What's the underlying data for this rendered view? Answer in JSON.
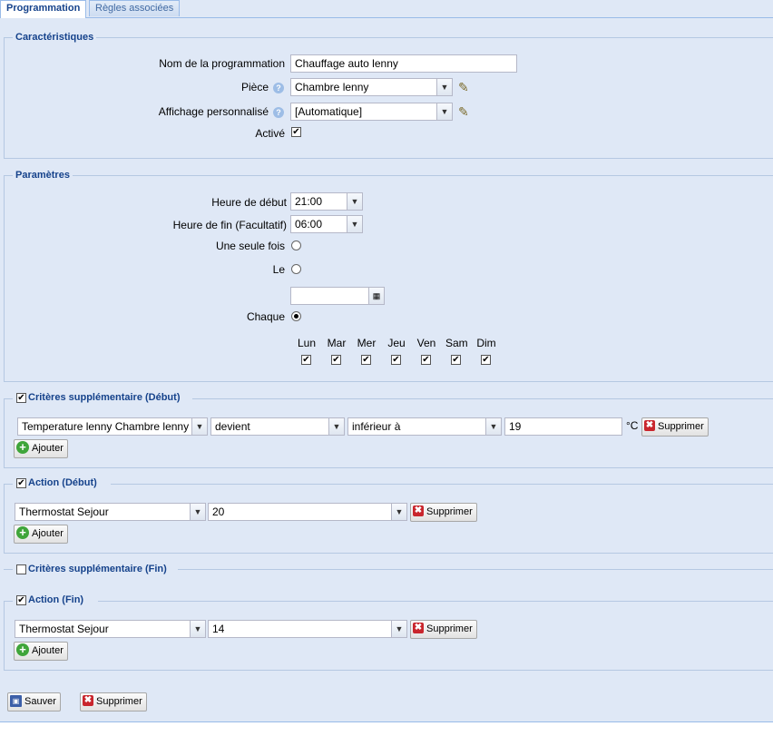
{
  "tabs": [
    {
      "label": "Programmation",
      "active": true
    },
    {
      "label": "Règles associées",
      "active": false
    }
  ],
  "characteristics": {
    "legend": "Caractéristiques",
    "name_label": "Nom de la programmation",
    "name_value": "Chauffage auto lenny",
    "room_label": "Pièce",
    "room_value": "Chambre lenny",
    "display_label": "Affichage personnalisé",
    "display_value": "[Automatique]",
    "active_label": "Activé",
    "active_checked": true
  },
  "parameters": {
    "legend": "Paramètres",
    "start_label": "Heure de début",
    "start_value": "21:00",
    "end_label": "Heure de fin (Facultatif)",
    "end_value": "06:00",
    "once_label": "Une seule fois",
    "on_label": "Le",
    "date_value": "",
    "every_label": "Chaque",
    "selected_mode": "every",
    "days": [
      {
        "label": "Lun",
        "checked": true
      },
      {
        "label": "Mar",
        "checked": true
      },
      {
        "label": "Mer",
        "checked": true
      },
      {
        "label": "Jeu",
        "checked": true
      },
      {
        "label": "Ven",
        "checked": true
      },
      {
        "label": "Sam",
        "checked": true
      },
      {
        "label": "Dim",
        "checked": true
      }
    ]
  },
  "criteria_start": {
    "legend": "Critères supplémentaire (Début)",
    "checked": true,
    "sensor": "Temperature lenny Chambre lenny",
    "condition": "devient",
    "operator": "inférieur à",
    "value": "19",
    "unit": "°C",
    "delete_label": "Supprimer",
    "add_label": "Ajouter"
  },
  "action_start": {
    "legend": "Action (Début)",
    "checked": true,
    "device": "Thermostat Sejour",
    "value": "20",
    "delete_label": "Supprimer",
    "add_label": "Ajouter"
  },
  "criteria_end": {
    "legend": "Critères supplémentaire (Fin)",
    "checked": false
  },
  "action_end": {
    "legend": "Action (Fin)",
    "checked": true,
    "device": "Thermostat Sejour",
    "value": "14",
    "delete_label": "Supprimer",
    "add_label": "Ajouter"
  },
  "footer": {
    "save_label": "Sauver",
    "delete_label": "Supprimer"
  },
  "icons": {
    "help": "help-icon",
    "edit": "pencil-icon",
    "dropdown": "chevron-down-icon",
    "calendar": "calendar-icon",
    "delete": "delete-icon",
    "add": "add-icon",
    "save": "floppy-disk-icon"
  }
}
